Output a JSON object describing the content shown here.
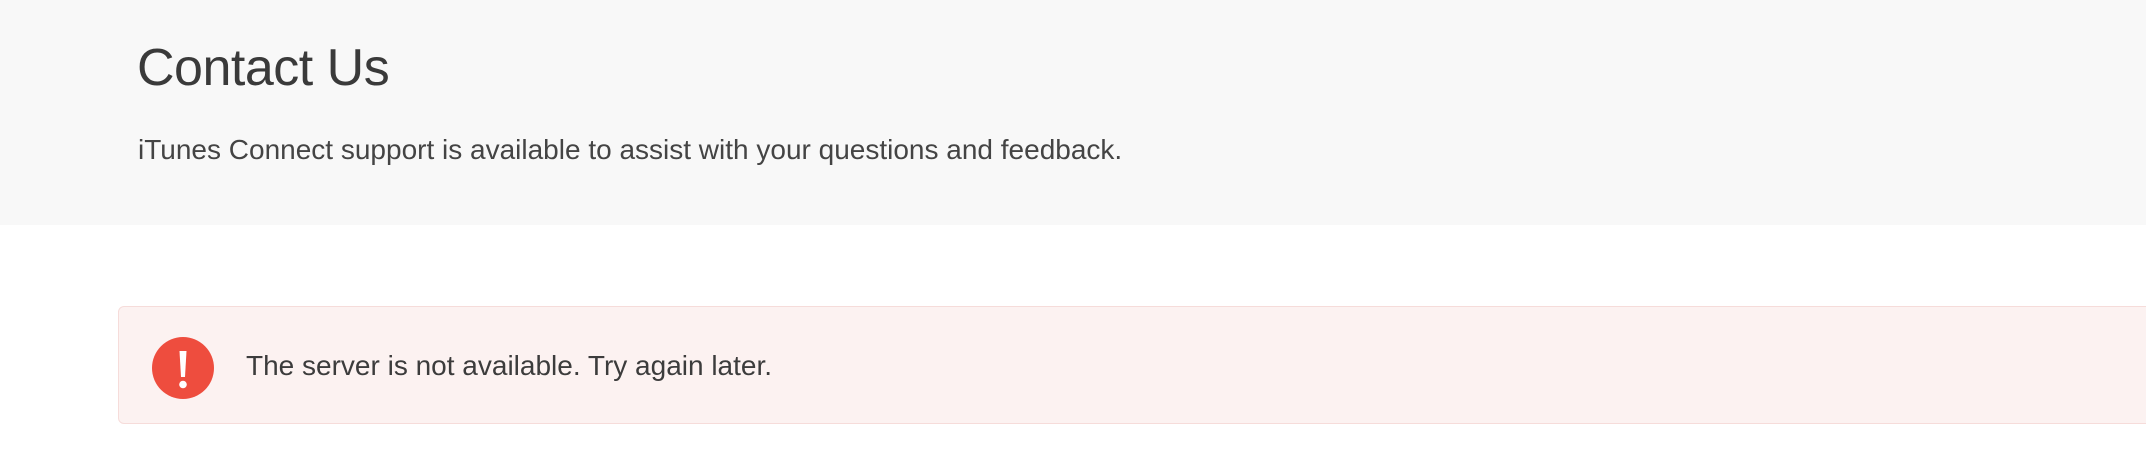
{
  "header": {
    "title": "Contact Us",
    "subtitle": "iTunes Connect support is available to assist with your questions and feedback."
  },
  "error_banner": {
    "icon": "exclamation-circle-icon",
    "message": "The server is not available. Try again later.",
    "icon_color": "#ee4d3e",
    "background_color": "#fcf2f1"
  },
  "colors": {
    "header_background": "#f8f8f8",
    "page_background": "#ffffff"
  }
}
